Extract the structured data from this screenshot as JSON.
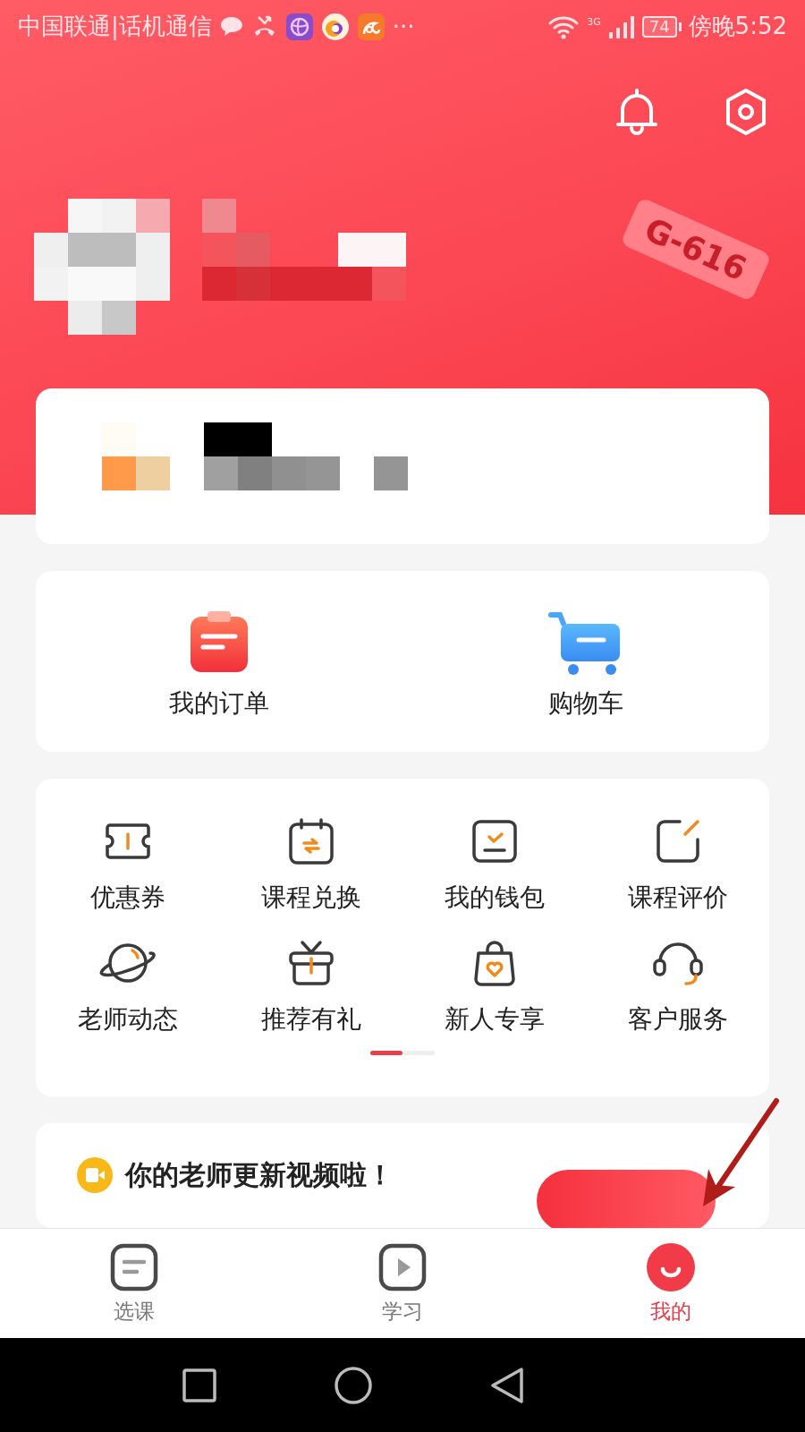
{
  "status_bar": {
    "carrier": "中国联通|话机通信",
    "more": "···",
    "network": "3G",
    "battery": "74",
    "time": "傍晚5:52"
  },
  "header": {
    "decoration_sign": "G-616"
  },
  "quick_links": [
    {
      "label": "我的订单"
    },
    {
      "label": "购物车"
    }
  ],
  "services": {
    "items": [
      {
        "label": "优惠券"
      },
      {
        "label": "课程兑换"
      },
      {
        "label": "我的钱包"
      },
      {
        "label": "课程评价"
      },
      {
        "label": "老师动态"
      },
      {
        "label": "推荐有礼"
      },
      {
        "label": "新人专享"
      },
      {
        "label": "客户服务"
      }
    ],
    "pages": [
      {
        "selected": true
      },
      {
        "selected": false
      }
    ]
  },
  "promo": {
    "title": "你的老师更新视频啦！"
  },
  "tabs": [
    {
      "label": "选课",
      "selected": false
    },
    {
      "label": "学习",
      "selected": false
    },
    {
      "label": "我的",
      "selected": true
    }
  ]
}
